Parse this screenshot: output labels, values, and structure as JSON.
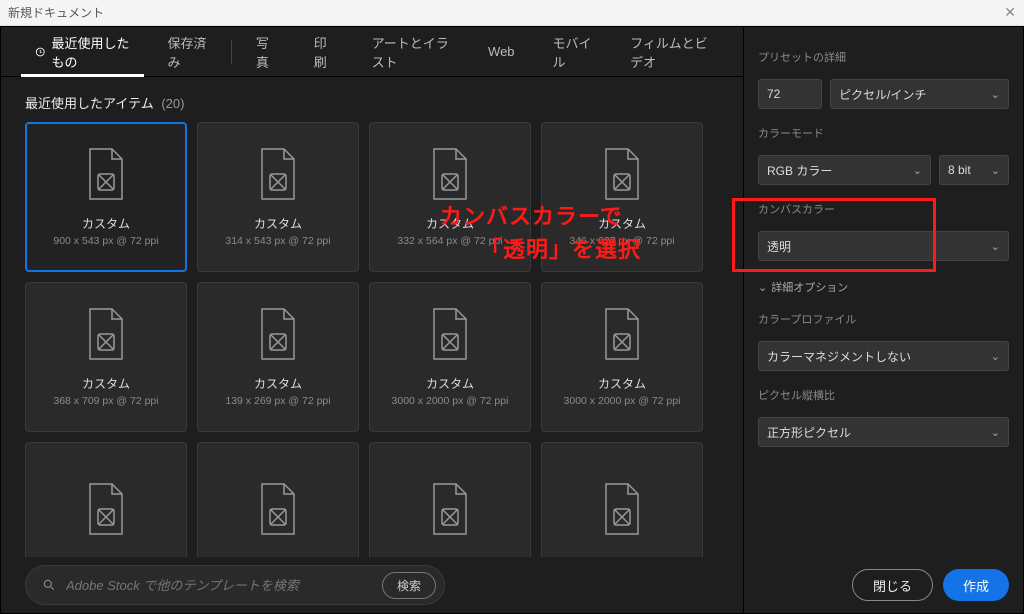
{
  "window": {
    "title": "新規ドキュメント",
    "close_glyph": "✕"
  },
  "tabs": [
    {
      "label": "最近使用したもの",
      "icon": "clock",
      "active": true
    },
    {
      "label": "保存済み"
    },
    {
      "label": "写真"
    },
    {
      "label": "印刷"
    },
    {
      "label": "アートとイラスト"
    },
    {
      "label": "Web"
    },
    {
      "label": "モバイル"
    },
    {
      "label": "フィルムとビデオ"
    }
  ],
  "recent": {
    "title": "最近使用したアイテム",
    "count": "(20)",
    "items": [
      {
        "label": "カスタム",
        "sub": "900 x 543 px @ 72 ppi",
        "selected": true
      },
      {
        "label": "カスタム",
        "sub": "314 x 543 px @ 72 ppi"
      },
      {
        "label": "カスタム",
        "sub": "332 x 564 px @ 72 ppi"
      },
      {
        "label": "カスタム",
        "sub": "346 x 627 px @ 72 ppi"
      },
      {
        "label": "カスタム",
        "sub": "368 x 709 px @ 72 ppi"
      },
      {
        "label": "カスタム",
        "sub": "139 x 269 px @ 72 ppi"
      },
      {
        "label": "カスタム",
        "sub": "3000 x 2000 px @ 72 ppi"
      },
      {
        "label": "カスタム",
        "sub": "3000 x 2000 px @ 72 ppi"
      },
      {
        "label": "",
        "sub": ""
      },
      {
        "label": "",
        "sub": ""
      },
      {
        "label": "",
        "sub": ""
      },
      {
        "label": "",
        "sub": ""
      }
    ]
  },
  "search": {
    "placeholder": "Adobe Stock で他のテンプレートを検索",
    "button": "検索"
  },
  "panel": {
    "preset_label": "プリセットの詳細",
    "resolution": "72",
    "resolution_unit": "ピクセル/インチ",
    "color_mode_label": "カラーモード",
    "color_mode": "RGB カラー",
    "bit_depth": "8 bit",
    "canvas_color_label": "カンバスカラー",
    "canvas_color": "透明",
    "advanced_label": "詳細オプション",
    "profile_label": "カラープロファイル",
    "profile": "カラーマネジメントしない",
    "aspect_label": "ピクセル縦横比",
    "aspect": "正方形ピクセル"
  },
  "actions": {
    "close": "閉じる",
    "create": "作成"
  },
  "annotation": {
    "line1": "カンバスカラーで",
    "line2": "「透明」を選択"
  }
}
